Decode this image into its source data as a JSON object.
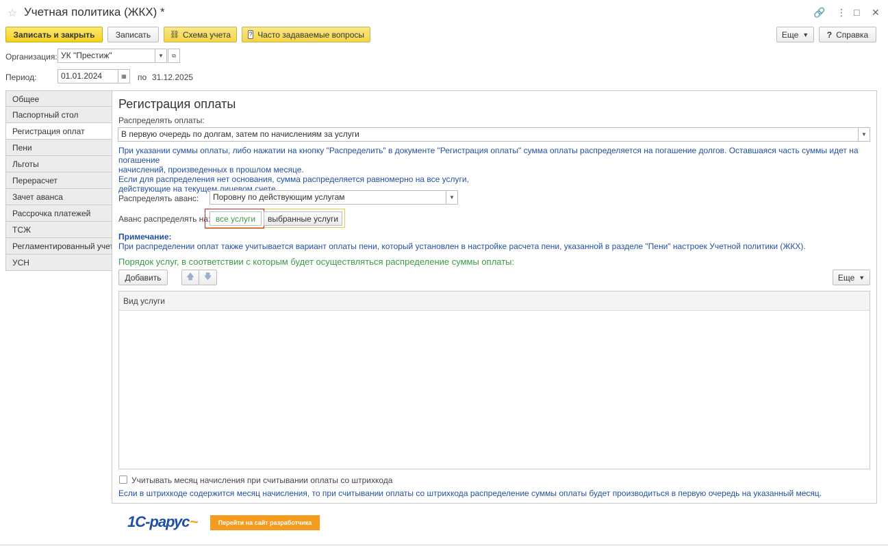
{
  "window": {
    "title": "Учетная политика (ЖКХ) *",
    "controls": [
      "🔗",
      "⋮",
      "□",
      "✕"
    ]
  },
  "toolbar": {
    "save_close": "Записать и закрыть",
    "save": "Записать",
    "scheme": "Схема учета",
    "faq": "Часто задаваемые вопросы",
    "more": "Еще",
    "help": "Справка"
  },
  "org": {
    "label": "Организация:",
    "value": "УК \"Престиж\""
  },
  "period": {
    "label": "Период:",
    "from": "01.01.2024",
    "to_label": "по",
    "to": "31.12.2025"
  },
  "tabs": [
    {
      "label": "Общее",
      "active": false
    },
    {
      "label": "Паспортный стол",
      "active": false
    },
    {
      "label": "Регистрация оплат",
      "active": true
    },
    {
      "label": "Пени",
      "active": false
    },
    {
      "label": "Льготы",
      "active": false
    },
    {
      "label": "Перерасчет",
      "active": false
    },
    {
      "label": "Зачет аванса",
      "active": false
    },
    {
      "label": "Рассрочка платежей",
      "active": false
    },
    {
      "label": "ТСЖ",
      "active": false
    },
    {
      "label": "Регламентированный учет",
      "active": false
    },
    {
      "label": "УСН",
      "active": false
    }
  ],
  "section": {
    "heading": "Регистрация оплаты",
    "distribute_label": "Распределять оплаты:",
    "distribute_value": "В первую очередь по долгам, затем по начислениям за услуги",
    "info_line1": "При указании суммы оплаты, либо нажатии на кнопку \"Распределить\" в документе \"Регистрация оплаты\" сумма оплаты распределяется на погашение долгов. Оставшаяся часть суммы идет на погашение",
    "info_line2": "начислений, произведенных в прошлом месяце.",
    "info_line3": "Если для распределения нет основания, сумма распределяется равномерно на все услуги,",
    "info_line4": "действующие на текущем лицевом счете.",
    "advance_label": "Распределять аванс:",
    "advance_value": "Поровну по действующим услугам",
    "advance_on_label": "Аванс распределять на:",
    "option_all": "все услуги",
    "option_selected": "выбранные услуги",
    "note_title": "Примечание:",
    "note_text": "При распределении оплат также учитывается вариант оплаты пени, который установлен в настройке расчета пени, указанной в разделе \"Пени\" настроек Учетной политики (ЖКХ).",
    "order_title": "Порядок услуг, в соответствии с которым будет осуществляться распределение суммы оплаты:",
    "add_button": "Добавить",
    "more_button": "Еще",
    "table_header": "Вид услуги",
    "checkbox_label": "Учитывать месяц начисления при считывании оплаты со штрихкода",
    "checkbox_checked": false,
    "barcode_info": "Если в штрихкоде содержится месяц начисления, то при считывании оплаты со штрихкода распределение суммы оплаты будет производиться в первую очередь на указанный месяц."
  },
  "footer": {
    "logo": "1С-рарус",
    "dev_button": "Перейти на сайт разработчика"
  }
}
